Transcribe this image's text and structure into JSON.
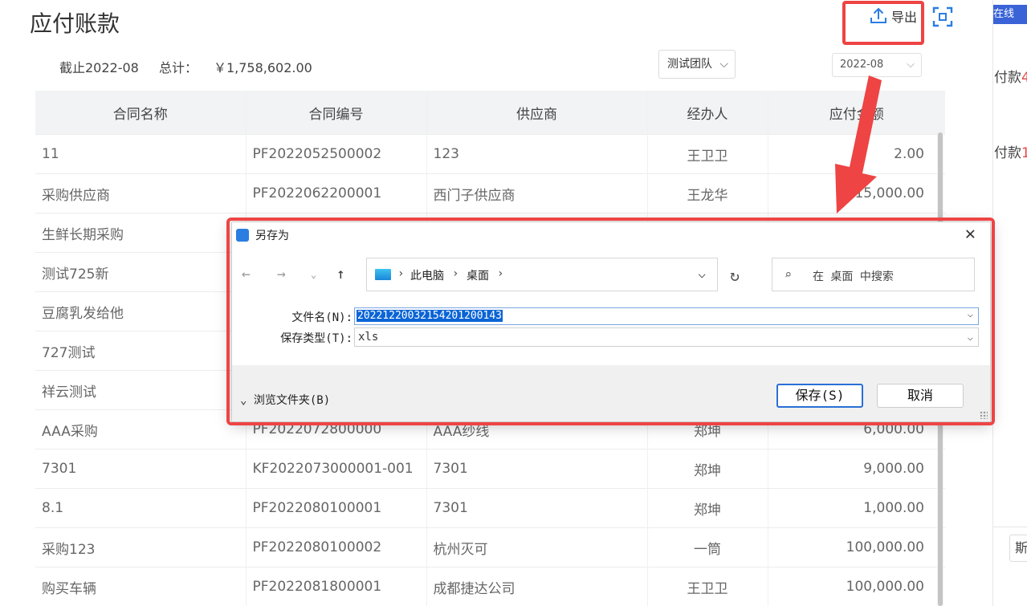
{
  "right_strip": {
    "tab": "在线",
    "line1_prefix": "付款",
    "line1_value": "4",
    "line2_prefix": "付款",
    "line2_value": "1",
    "button": "斯"
  },
  "page": {
    "title": "应付账款",
    "export_label": "导出"
  },
  "summary": {
    "as_of": "截止2022-08",
    "total_label": "总计：",
    "total_value": "￥1,758,602.00"
  },
  "filters": {
    "team": "测试团队",
    "date": "2022-08"
  },
  "table": {
    "headers": [
      "合同名称",
      "合同编号",
      "供应商",
      "经办人",
      "应付金额"
    ],
    "rows": [
      [
        "11",
        "PF2022052500002",
        "123",
        "王卫卫",
        "2.00"
      ],
      [
        "采购供应商",
        "PF2022062200001",
        "西门子供应商",
        "王龙华",
        "15,000.00"
      ],
      [
        "生鲜长期采购",
        "",
        "",
        "",
        ""
      ],
      [
        "测试725新",
        "",
        "",
        "",
        ""
      ],
      [
        "豆腐乳发给他",
        "",
        "",
        "",
        ""
      ],
      [
        "727测试",
        "",
        "",
        "",
        ""
      ],
      [
        "祥云测试",
        "",
        "",
        "",
        ""
      ],
      [
        "AAA采购",
        "PF2022072800000",
        "AAA纱线",
        "郑坤",
        "6,000.00"
      ],
      [
        "7301",
        "KF2022073000001-001",
        "7301",
        "郑坤",
        "9,000.00"
      ],
      [
        "8.1",
        "PF2022080100001",
        "7301",
        "郑坤",
        "1,000.00"
      ],
      [
        "采购123",
        "PF2022080100002",
        "杭州灭可",
        "一筒",
        "100,000.00"
      ],
      [
        "购买车辆",
        "PF2022081800001",
        "成都捷达公司",
        "王卫卫",
        "100,000.00"
      ]
    ]
  },
  "dialog": {
    "title": "另存为",
    "breadcrumb": [
      "此电脑",
      "桌面"
    ],
    "search_placeholder": "在 桌面 中搜索",
    "filename_label": "文件名(N):",
    "filename_value": "20221220032154201200143",
    "filetype_label": "保存类型(T):",
    "filetype_value": "xls",
    "browse_label": "浏览文件夹(B)",
    "save_label": "保存(S)",
    "cancel_label": "取消"
  }
}
